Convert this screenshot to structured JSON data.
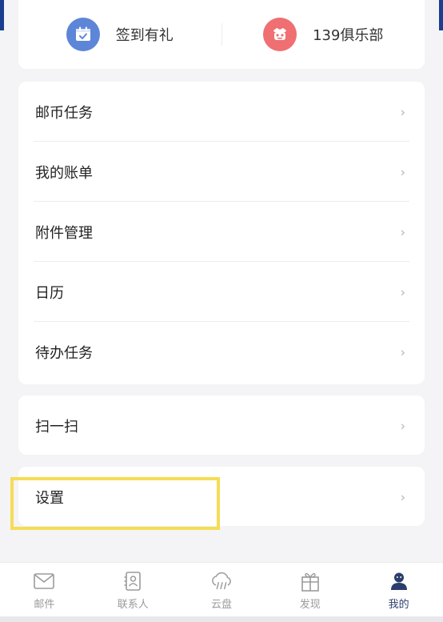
{
  "quick_actions": [
    {
      "label": "签到有礼",
      "icon": "calendar-check-icon",
      "color": "#5d86d8"
    },
    {
      "label": "139俱乐部",
      "icon": "club-robot-icon",
      "color": "#ef6f72"
    }
  ],
  "menu_group": [
    {
      "label": "邮币任务"
    },
    {
      "label": "我的账单"
    },
    {
      "label": "附件管理"
    },
    {
      "label": "日历"
    },
    {
      "label": "待办任务"
    }
  ],
  "scan": {
    "label": "扫一扫"
  },
  "settings": {
    "label": "设置"
  },
  "chevron": "›",
  "tabs": [
    {
      "label": "邮件",
      "icon": "mail-icon",
      "active": false
    },
    {
      "label": "联系人",
      "icon": "contacts-icon",
      "active": false
    },
    {
      "label": "云盘",
      "icon": "cloud-icon",
      "active": false
    },
    {
      "label": "发现",
      "icon": "gift-icon",
      "active": false
    },
    {
      "label": "我的",
      "icon": "user-icon",
      "active": true
    }
  ],
  "colors": {
    "brand": "#1b3f8f",
    "highlight": "#f5dc55",
    "active_tab": "#2c3e6b"
  }
}
